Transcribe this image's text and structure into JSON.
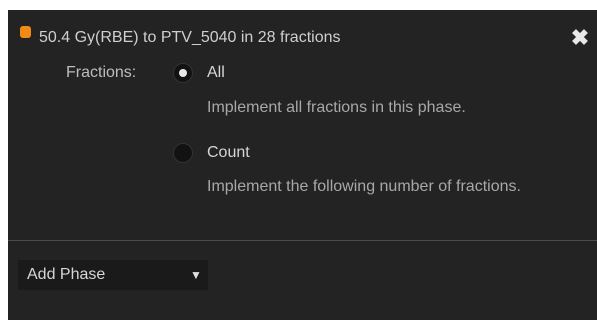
{
  "phase": {
    "title": "50.4 Gy(RBE) to PTV_5040 in 28 fractions",
    "marker_color": "#f28a16",
    "close_icon": "✖"
  },
  "fractions": {
    "label": "Fractions:",
    "selected": "All",
    "options": [
      {
        "label": "All",
        "description": "Implement all fractions in this phase."
      },
      {
        "label": "Count",
        "description": "Implement the following number of fractions."
      }
    ]
  },
  "add_phase": {
    "label": "Add Phase",
    "arrow": "▼"
  }
}
